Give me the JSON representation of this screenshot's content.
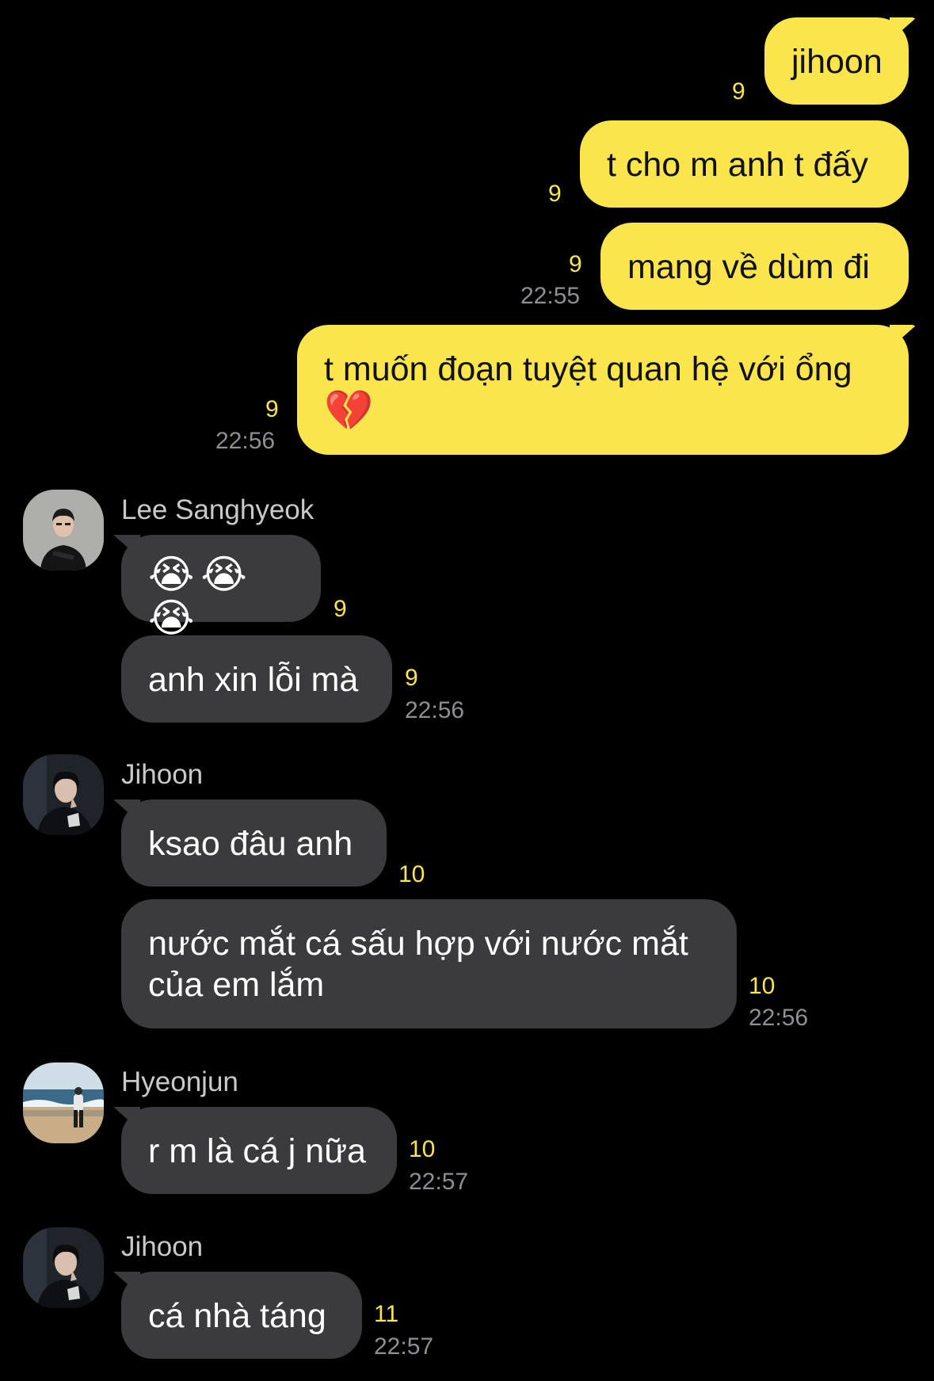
{
  "outgoing": [
    {
      "text": "jihoon",
      "unread": "9",
      "time": ""
    },
    {
      "text": "t cho m anh t đấy",
      "unread": "9",
      "time": ""
    },
    {
      "text": "mang về dùm đi",
      "unread": "9",
      "time": "22:55"
    },
    {
      "text": "t muốn đoạn tuyệt quan hệ với ổng",
      "emoji": "💔",
      "unread": "9",
      "time": "22:56"
    }
  ],
  "groups": [
    {
      "sender": "Lee Sanghyeok",
      "avatar": "lee-sanghyeok-avatar",
      "messages": [
        {
          "text": "😭😭😭",
          "unread": "9",
          "time": ""
        },
        {
          "text": "anh xin lỗi mà",
          "unread": "9",
          "time": "22:56"
        }
      ]
    },
    {
      "sender": "Jihoon",
      "avatar": "jihoon-avatar",
      "messages": [
        {
          "text": "ksao đâu anh",
          "unread": "10",
          "time": ""
        },
        {
          "text": "nước mắt cá sấu hợp với nước mắt của em lắm",
          "unread": "10",
          "time": "22:56"
        }
      ]
    },
    {
      "sender": "Hyeonjun",
      "avatar": "hyeonjun-avatar",
      "messages": [
        {
          "text": "r m là cá j nữa",
          "unread": "10",
          "time": "22:57"
        }
      ]
    },
    {
      "sender": "Jihoon",
      "avatar": "jihoon-avatar",
      "messages": [
        {
          "text": "cá nhà táng",
          "unread": "11",
          "time": "22:57"
        }
      ]
    }
  ],
  "colors": {
    "background": "#000000",
    "outgoing_bubble": "#fbe54d",
    "incoming_bubble": "#3b3b3d",
    "unread_count": "#fbe54d",
    "timestamp": "#8e8e93"
  }
}
